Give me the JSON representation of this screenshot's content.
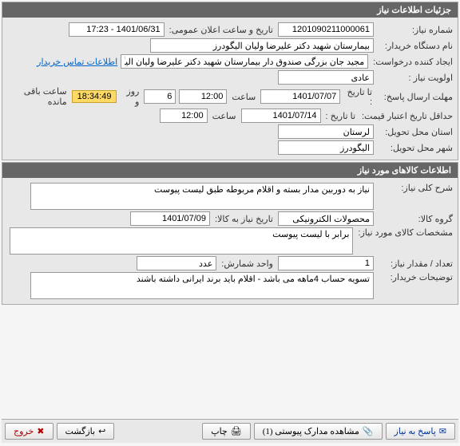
{
  "panel1": {
    "title": "جزئیات اطلاعات نیاز",
    "need_number_label": "شماره نیاز:",
    "need_number": "1201090211000061",
    "public_datetime_label": "تاریخ و ساعت اعلان عمومی:",
    "public_datetime": "1401/06/31 - 17:23",
    "buyer_org_label": "نام دستگاه خریدار:",
    "buyer_org": "بیمارستان شهید دکتر علیرضا ولیان الیگودرز",
    "creator_label": "ایجاد کننده درخواست:",
    "creator": "مجید جان بزرگی صندوق دار بیمارستان شهید دکتر علیرضا ولیان الیگودرز",
    "contact_link": "اطلاعات تماس خریدار",
    "priority_label": "اولویت نیاز :",
    "priority": "عادی",
    "reply_deadline_label": "مهلت ارسال پاسخ:",
    "to_date_label": "تا تاریخ :",
    "reply_date": "1401/07/07",
    "time_label": "ساعت",
    "reply_time": "12:00",
    "days_value": "6",
    "days_and_label": "روز و",
    "time_remaining": "18:34:49",
    "time_remaining_suffix": "ساعت باقی مانده",
    "validity_label": "حداقل تاریخ اعتبار قیمت:",
    "validity_date": "1401/07/14",
    "validity_time": "12:00",
    "province_label": "استان محل تحویل:",
    "province": "لرستان",
    "city_label": "شهر محل تحویل:",
    "city": "الیگودرز"
  },
  "panel2": {
    "title": "اطلاعات کالاهای مورد نیاز",
    "desc_label": "شرح کلی نیاز:",
    "desc": "نیاز به دوربین مدار بسته و اقلام مربوطه طبق لیست پیوست",
    "group_label": "گروه کالا:",
    "group": "محصولات الکترونیکی",
    "need_date_label": "تاریخ نیاز به کالا:",
    "need_date": "1401/07/09",
    "spec_label": "مشخصات کالای مورد نیاز:",
    "spec": "برابر با لیست پیوست",
    "qty_label": "تعداد / مقدار نیاز:",
    "qty": "1",
    "unit_label": "واحد شمارش:",
    "unit": "عدد",
    "buyer_notes_label": "توضیحات خریدار:",
    "buyer_notes": "تسویه حساب 4ماهه می باشد - اقلام باید برند ایرانی داشته باشند"
  },
  "footer": {
    "reply": "پاسخ به نیاز",
    "attachments": "مشاهده مدارک پیوستی (1)",
    "print": "چاپ",
    "back": "بازگشت",
    "exit": "خروج"
  }
}
